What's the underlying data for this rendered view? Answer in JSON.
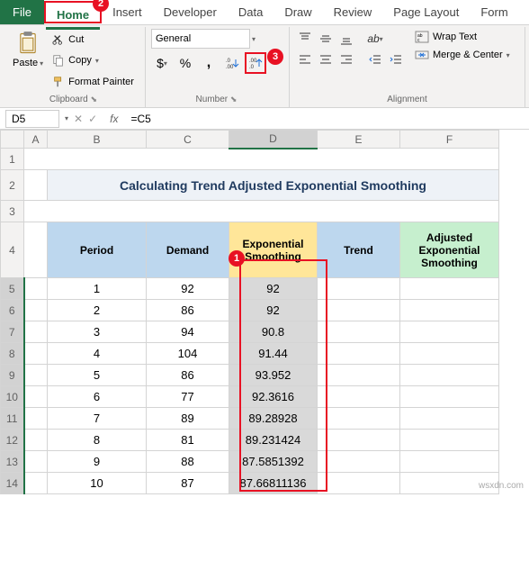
{
  "tabs": {
    "file": "File",
    "home": "Home",
    "insert": "Insert",
    "developer": "Developer",
    "data": "Data",
    "draw": "Draw",
    "review": "Review",
    "pagelayout": "Page Layout",
    "formulas": "Form"
  },
  "clipboard": {
    "paste": "Paste",
    "cut": "Cut",
    "copy": "Copy",
    "format_painter": "Format Painter",
    "group": "Clipboard"
  },
  "number": {
    "format": "General",
    "group": "Number"
  },
  "alignment": {
    "wrap": "Wrap Text",
    "merge": "Merge & Center",
    "group": "Alignment"
  },
  "namebox": "D5",
  "formula": "=C5",
  "cols": [
    "A",
    "B",
    "C",
    "D",
    "E",
    "F"
  ],
  "rows": [
    "1",
    "2",
    "3",
    "4",
    "5",
    "6",
    "7",
    "8",
    "9",
    "10",
    "11",
    "12",
    "13",
    "14"
  ],
  "title": "Calculating Trend Adjusted Exponential Smoothing",
  "headers": {
    "period": "Period",
    "demand": "Demand",
    "exps": "Exponential Smoothing",
    "trend": "Trend",
    "adj": "Adjusted Exponential Smoothing"
  },
  "chart_data": {
    "type": "table",
    "columns": [
      "Period",
      "Demand",
      "Exponential Smoothing",
      "Trend",
      "Adjusted Exponential Smoothing"
    ],
    "rows": [
      {
        "period": "1",
        "demand": "92",
        "exps": "92"
      },
      {
        "period": "2",
        "demand": "86",
        "exps": "92"
      },
      {
        "period": "3",
        "demand": "94",
        "exps": "90.8"
      },
      {
        "period": "4",
        "demand": "104",
        "exps": "91.44"
      },
      {
        "period": "5",
        "demand": "86",
        "exps": "93.952"
      },
      {
        "period": "6",
        "demand": "77",
        "exps": "92.3616"
      },
      {
        "period": "7",
        "demand": "89",
        "exps": "89.28928"
      },
      {
        "period": "8",
        "demand": "81",
        "exps": "89.231424"
      },
      {
        "period": "9",
        "demand": "88",
        "exps": "87.5851392"
      },
      {
        "period": "10",
        "demand": "87",
        "exps": "87.66811136"
      }
    ]
  },
  "callouts": {
    "c1": "1",
    "c2": "2",
    "c3": "3"
  },
  "watermark": "wsxdn.com"
}
